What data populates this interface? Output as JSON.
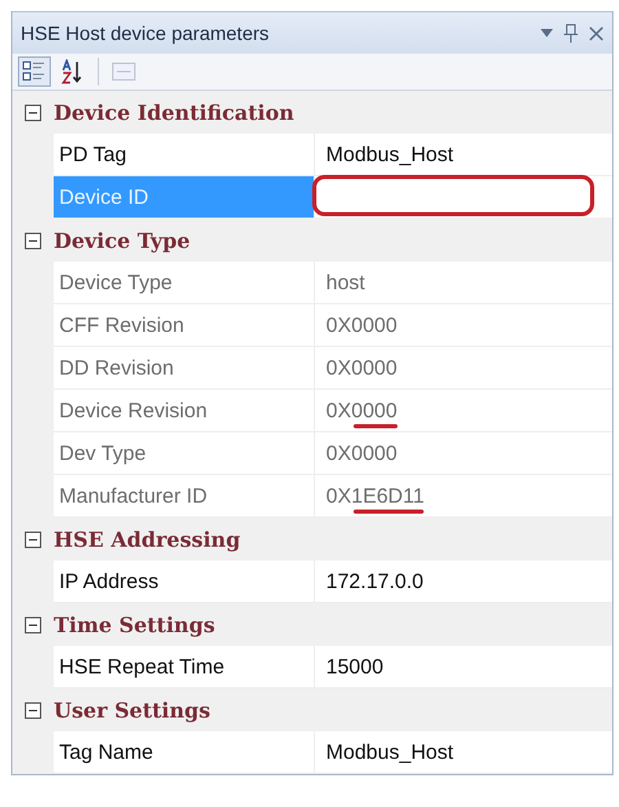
{
  "window": {
    "title": "HSE Host device parameters"
  },
  "toolbar": [
    {
      "kind": "categorized",
      "selected": true,
      "disabled": false
    },
    {
      "kind": "alphabetical",
      "selected": false,
      "disabled": false
    },
    {
      "kind": "pages",
      "selected": false,
      "disabled": true
    }
  ],
  "sections": [
    {
      "title": "Device Identification",
      "expanded": true,
      "properties": [
        {
          "name": "PD Tag",
          "value": "Modbus_Host",
          "readonly": false,
          "selected": false
        },
        {
          "name": "Device ID",
          "readonly": false,
          "selected": true,
          "circled": true
        }
      ]
    },
    {
      "title": "Device Type",
      "expanded": true,
      "properties": [
        {
          "name": "Device Type",
          "value": "host",
          "readonly": true,
          "selected": false
        },
        {
          "name": "CFF Revision",
          "value": "0X0000",
          "readonly": true,
          "selected": false
        },
        {
          "name": "DD Revision",
          "value": "0X0000",
          "readonly": true,
          "selected": false
        },
        {
          "name": "Device Revision",
          "value": "0X0000",
          "readonly": true,
          "selected": false,
          "underlined": true
        },
        {
          "name": "Dev Type",
          "value": "0X0000",
          "readonly": true,
          "selected": false
        },
        {
          "name": "Manufacturer ID",
          "value": "0X1E6D11",
          "readonly": true,
          "selected": false,
          "underlined": true
        }
      ]
    },
    {
      "title": "HSE Addressing",
      "expanded": true,
      "properties": [
        {
          "name": "IP Address",
          "value": "172.17.0.0",
          "readonly": false,
          "selected": false
        }
      ]
    },
    {
      "title": "Time Settings",
      "expanded": true,
      "properties": [
        {
          "name": "HSE Repeat Time",
          "value": "15000",
          "readonly": false,
          "selected": false
        }
      ]
    },
    {
      "title": "User Settings",
      "expanded": true,
      "properties": [
        {
          "name": "Tag Name",
          "value": "Modbus_Host",
          "readonly": false,
          "selected": false
        }
      ]
    }
  ]
}
